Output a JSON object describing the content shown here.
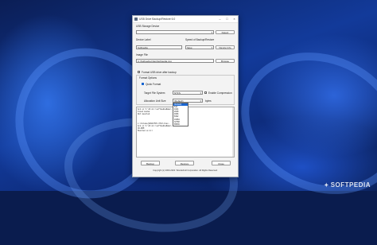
{
  "window": {
    "title": "USB Drive Backup/Restore 6.0"
  },
  "usb": {
    "label": "USB Storage Device",
    "device_value": "",
    "detect_label": "Detect"
  },
  "device_label": {
    "label": "Device Label",
    "value": "Softpedia"
  },
  "speed": {
    "label": "Speed of Backup/Restore",
    "value": "Slow"
  },
  "device_info_label": "Device Info",
  "image_file": {
    "label": "Image File",
    "value": "C:\\Softpedia Files\\Softpedia.img",
    "browse_label": "Browse"
  },
  "format_after_label": "Format USB drive after backup",
  "format_options": {
    "label": "Format Options",
    "quick_format_label": "Quick Format",
    "target_fs_label": "Target File System",
    "target_fs_value": "NTFS",
    "compression_label": "Enable Compression",
    "alloc_label": "Allocation Unit Size",
    "alloc_value": "(Default)",
    "bytes_label": "bytes",
    "alloc_options": [
      "(Default)",
      "512",
      "1024",
      "2048",
      "4096",
      "8192",
      "16384",
      "32768",
      "65536"
    ]
  },
  "log_lines": [
    "Ack on V:\\Fi\\ck:\\softmediaName\\",
    "Fixed media",
    "Not mounted",
    "",
    "",
    "",
    "L:\\Volume{b0913f45-3fe5-11ec-",
    "Ack on V:\\Fi\\ck:\\softmediaName\\",
    "CD-ROM",
    "Mounted on E:\\"
  ],
  "buttons": {
    "backup": "Backup",
    "restore": "Restore",
    "close": "Close"
  },
  "footer": "Copyright (c) 2000-2022. Wonderbull Corporation. All Rights Reserved.",
  "watermark": "SOFTPEDIA",
  "colors": {
    "accent": "#1a66d1",
    "desktop": "#123a9a"
  }
}
